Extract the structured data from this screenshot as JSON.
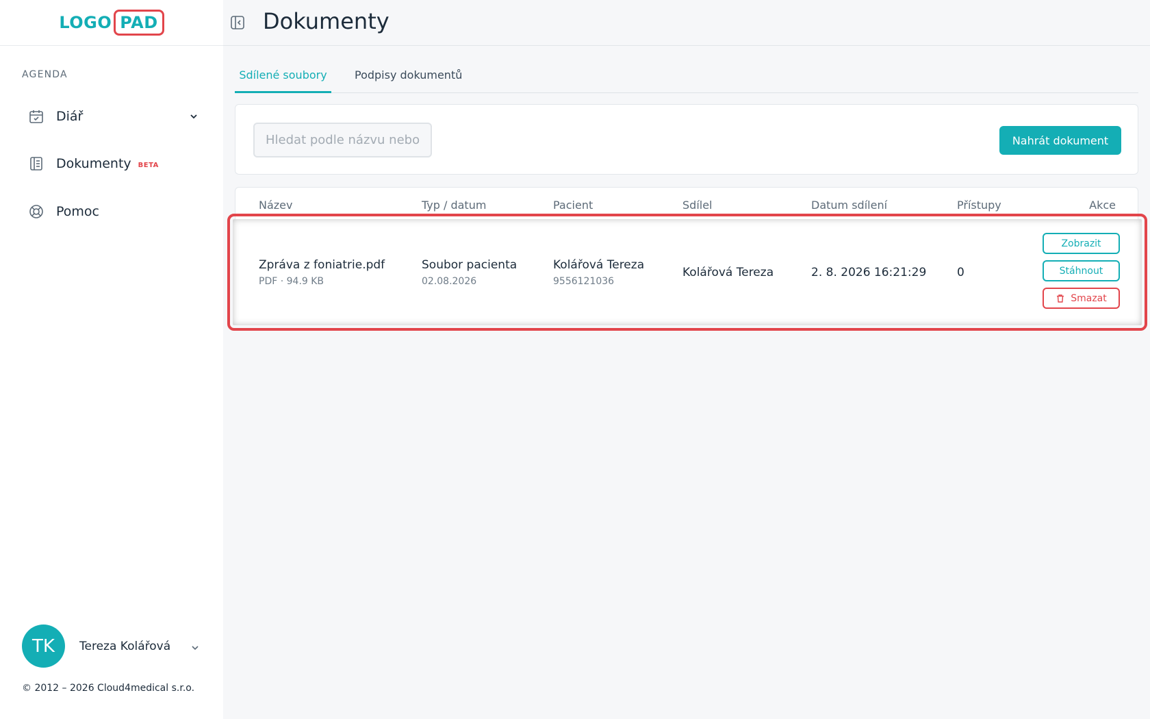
{
  "logo": {
    "part1": "LOGO",
    "part2": "PAD"
  },
  "sidebar": {
    "section_label": "AGENDA",
    "items": [
      {
        "label": "Diář",
        "icon": "calendar-check-icon"
      },
      {
        "label": "Dokumenty",
        "badge": "BETA",
        "icon": "document-list-icon"
      },
      {
        "label": "Pomoc",
        "icon": "lifebuoy-icon"
      }
    ]
  },
  "user": {
    "initials": "TK",
    "name": "Tereza Kolářová"
  },
  "footer": {
    "copyright": "© 2012 – 2026 Cloud4medical s.r.o."
  },
  "header": {
    "title": "Dokumenty"
  },
  "tabs": [
    {
      "label": "Sdílené soubory",
      "active": true
    },
    {
      "label": "Podpisy dokumentů",
      "active": false
    }
  ],
  "search": {
    "placeholder": "Hledat podle názvu nebo pacienta",
    "value": ""
  },
  "toolbar": {
    "upload_label": "Nahrát dokument"
  },
  "table": {
    "columns": [
      "Název",
      "Typ / datum",
      "Pacient",
      "Sdílel",
      "Datum sdílení",
      "Přístupy",
      "Akce"
    ],
    "rows": [
      {
        "name": "Zpráva z foniatrie.pdf",
        "file_meta": "PDF · 94.9 KB",
        "type": "Soubor pacienta",
        "type_date": "02.08.2026",
        "patient": "Kolářová Tereza",
        "patient_id": "9556121036",
        "shared_by": "Kolářová Tereza",
        "shared_date": "2. 8. 2026 16:21:29",
        "access_count": "0",
        "actions": {
          "view": "Zobrazit",
          "download": "Stáhnout",
          "delete": "Smazat"
        }
      }
    ]
  },
  "colors": {
    "accent": "#14aeb5",
    "danger": "#e2454b",
    "text": "#1c2b3a"
  }
}
